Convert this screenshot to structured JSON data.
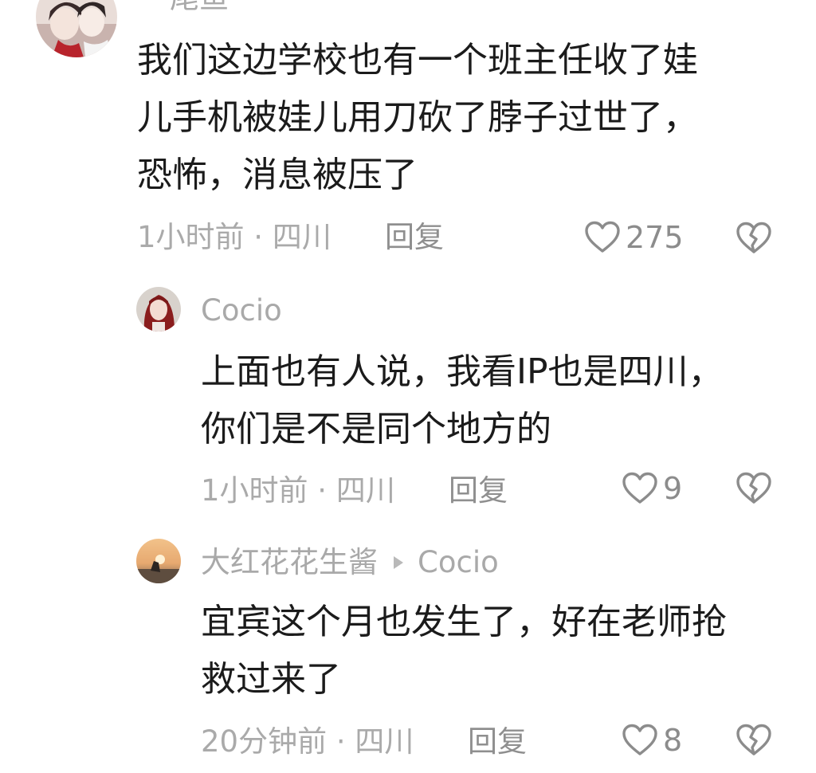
{
  "comments": [
    {
      "author": "尾鱼",
      "content": "我们这边学校也有一个班主任收了娃\n儿手机被娃儿用刀砍了脖子过世了，\n恐怖，消息被压了",
      "meta": "1小时前 · 四川",
      "reply_label": "回复",
      "likes": "275"
    },
    {
      "author": "Cocio",
      "content": "上面也有人说，我看IP也是四川，\n你们是不是同个地方的",
      "meta": "1小时前 · 四川",
      "reply_label": "回复",
      "likes": "9"
    },
    {
      "author": "大红花花生酱",
      "reply_to": "Cocio",
      "content": "宜宾这个月也发生了，好在老师抢\n救过来了",
      "meta": "20分钟前 · 四川",
      "reply_label": "回复",
      "likes": "8"
    }
  ],
  "icons": {
    "like": "heart-outline-icon",
    "dislike": "broken-heart-icon"
  },
  "colors": {
    "content": "#1b1b1b",
    "secondary": "#aaaaaa",
    "icon": "#8c8c8c"
  }
}
